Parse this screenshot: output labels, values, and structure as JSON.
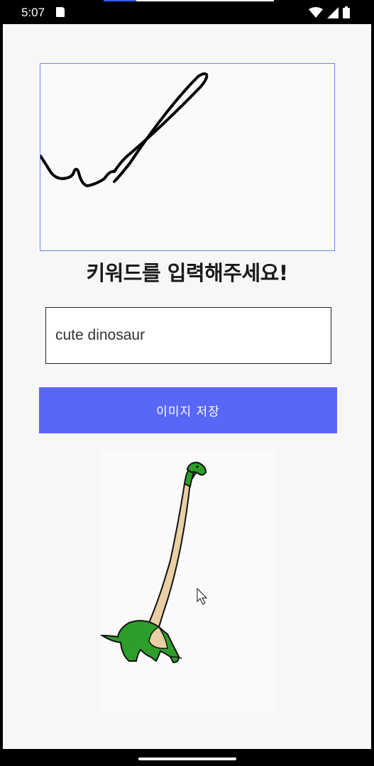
{
  "status_bar": {
    "time": "5:07",
    "icons": [
      "document-icon",
      "wifi-icon",
      "signal-icon",
      "battery-icon"
    ]
  },
  "drawing_canvas": {
    "border_color": "#6d88ef",
    "stroke_color": "#000000"
  },
  "main": {
    "title": "키워드를 입력해주세요!",
    "keyword_input": {
      "value": "cute dinosaur"
    },
    "save_button_label": "이미지 저장",
    "accent_color": "#5867f7"
  },
  "result_image": {
    "subject": "dinosaur-illustration"
  }
}
